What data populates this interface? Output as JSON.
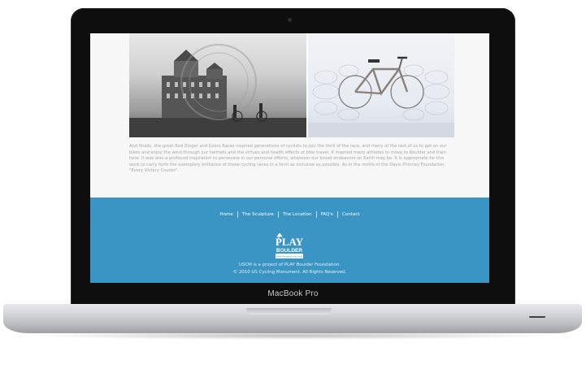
{
  "article": {
    "paragraph": "And finally, the great Red Zinger and Coors Races inspired generations of cyclists to join the thrill of the race, and many of the rest of us to get on our bikes and enjoy the wind through our helmets and the virtues and health effects of bike travel. It inspired many athletes to move to Boulder and train here. It was also a profound inspiration to persevere in our personal efforts, whatever our broad endeavors on Earth may be. It is appropriate for this work to carry forth the exemplary brilliance of these cycling races in a form as inclusive as possible. As in the motto of the Davis Phinney Foundation, \"Every Victory Counts\"."
  },
  "footer": {
    "nav": [
      {
        "label": "Home"
      },
      {
        "label": "The Sculpture"
      },
      {
        "label": "The Location"
      },
      {
        "label": "FAQ's"
      },
      {
        "label": "Contact"
      }
    ],
    "logo_text_top": "PLAY",
    "logo_text_bottom": "BOULDER",
    "logo_tagline": "Parks Recreation And Youth",
    "line1": "USCM is a project of PLAY Boulder Foundation.",
    "line2": "© 2010 US Cycling Monument. All Rights Reserved.",
    "background_color": "#3b95c4"
  },
  "device": {
    "brand": "MacBook Pro"
  }
}
